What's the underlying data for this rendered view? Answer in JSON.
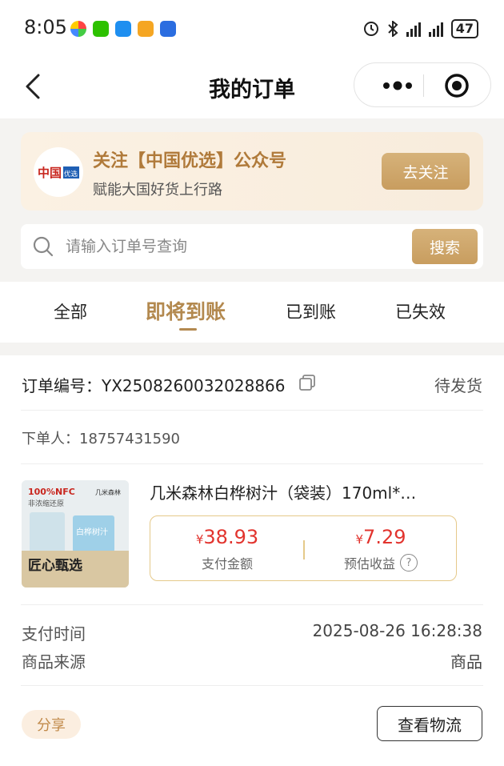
{
  "status_bar": {
    "time": "8:05",
    "battery": "47"
  },
  "nav": {
    "title": "我的订单"
  },
  "promo": {
    "logo_text": "中国优选",
    "title": "关注【中国优选】公众号",
    "subtitle": "赋能大国好货上行路",
    "button": "去关注"
  },
  "search": {
    "placeholder": "请输入订单号查询",
    "button": "搜索"
  },
  "tabs": [
    {
      "label": "全部"
    },
    {
      "label": "即将到账",
      "active": true
    },
    {
      "label": "已到账"
    },
    {
      "label": "已失效"
    }
  ],
  "order": {
    "number_label": "订单编号：YX2508260032028866",
    "status": "待发货",
    "buyer": "下单人：18757431590",
    "product": {
      "name": "几米森林白桦树汁（袋装）170ml*…",
      "thumb_text": {
        "badge": "100%NFC",
        "sub": "非浓缩还原",
        "brand": "几米森林",
        "product": "白桦树汁",
        "slogan": "匠心甄选"
      }
    },
    "currency": "¥",
    "pay_amount": "38.93",
    "pay_label": "支付金额",
    "earning": "7.29",
    "earning_label": "预估收益",
    "help_icon": "question-icon",
    "pay_time_label": "支付时间",
    "pay_time": "2025-08-26 16:28:38",
    "source_label": "商品来源",
    "source": "商品",
    "share_button": "分享",
    "logistics_button": "查看物流"
  },
  "colors": {
    "accent": "#b3894f",
    "price": "#e2342e",
    "promo_bg": "#fbf1e3"
  }
}
